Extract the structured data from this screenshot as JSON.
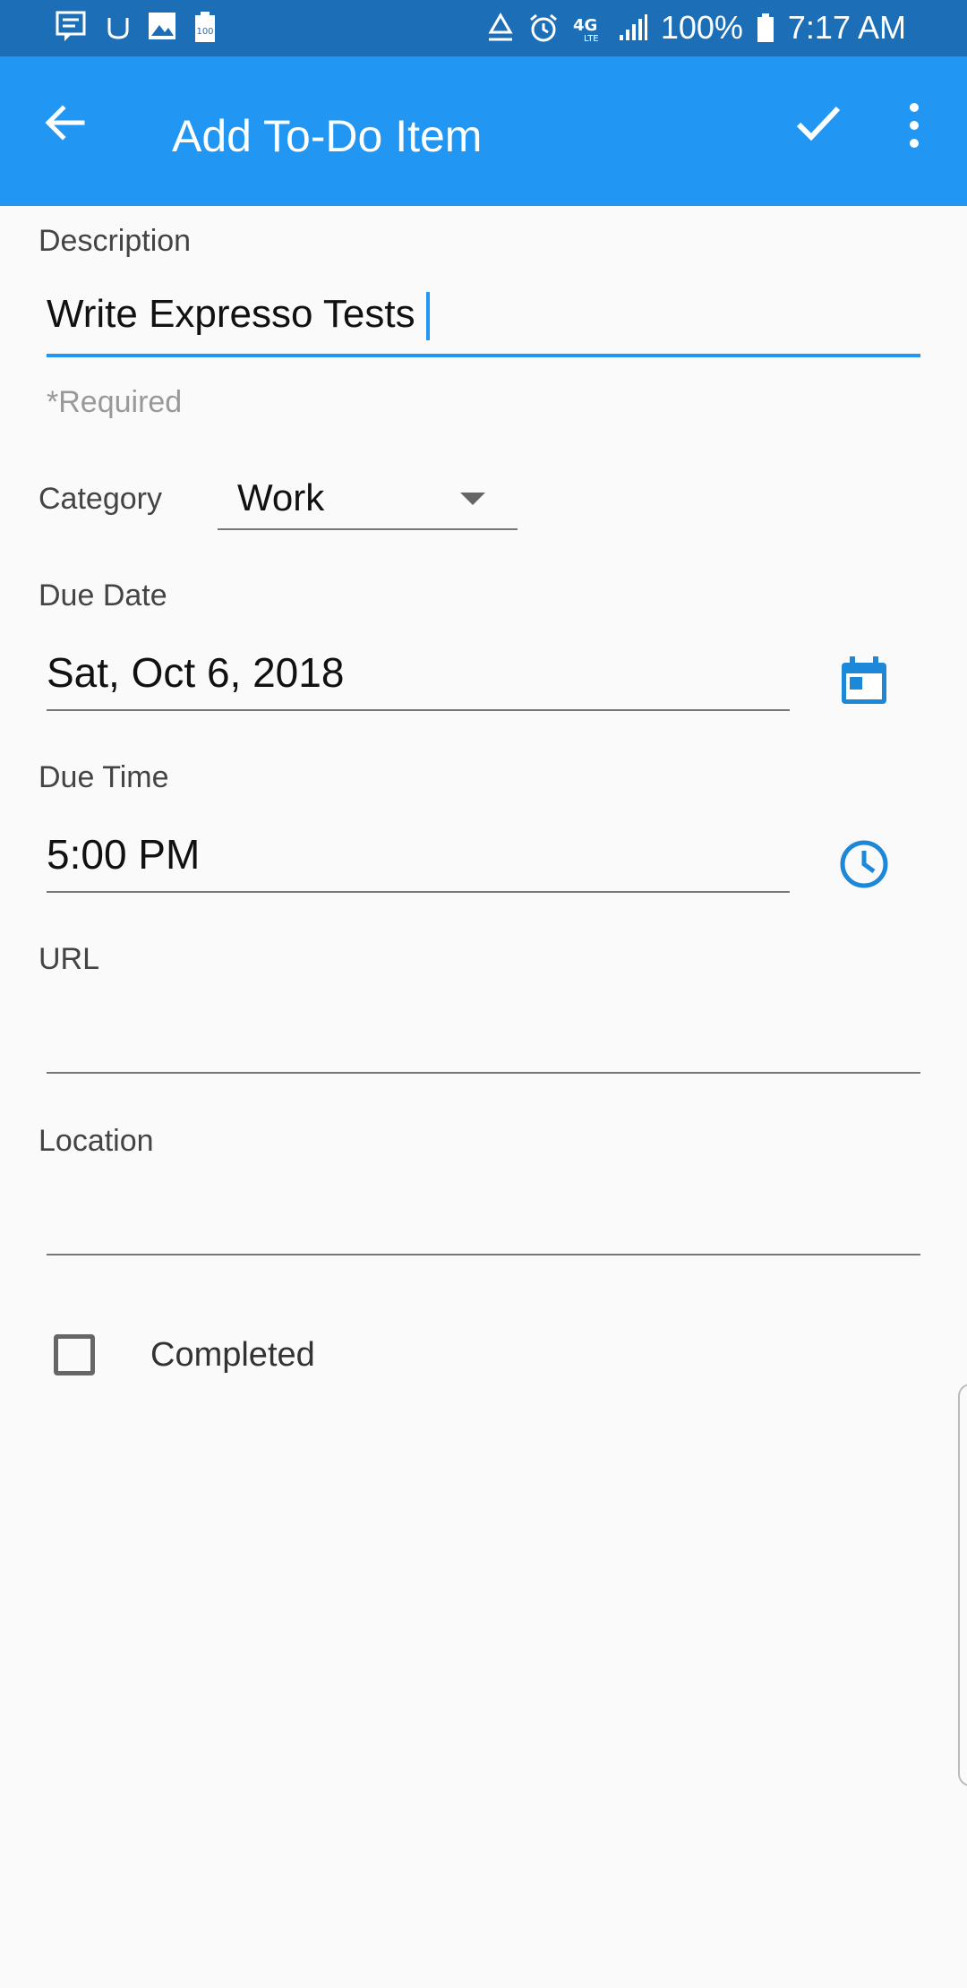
{
  "status_bar": {
    "battery": "100%",
    "time": "7:17 AM",
    "left_icons": [
      "chat-icon",
      "udacity-icon",
      "image-icon",
      "battery-100-icon"
    ],
    "right_icons": [
      "recycle-icon",
      "alarm-icon",
      "4g-lte-icon",
      "signal-icon",
      "battery-icon"
    ],
    "network_label": "4G"
  },
  "app_bar": {
    "title": "Add To-Do Item",
    "color": "#2196f3",
    "status_color": "#1c6fb6"
  },
  "form": {
    "description": {
      "label": "Description",
      "value": "Write Expresso Tests",
      "hint": "*Required"
    },
    "category": {
      "label": "Category",
      "selected": "Work"
    },
    "due_date": {
      "label": "Due Date",
      "value": "Sat, Oct 6, 2018"
    },
    "due_time": {
      "label": "Due Time",
      "value": "5:00 PM"
    },
    "url": {
      "label": "URL",
      "value": ""
    },
    "location": {
      "label": "Location",
      "value": ""
    },
    "completed": {
      "label": "Completed",
      "checked": false
    }
  }
}
